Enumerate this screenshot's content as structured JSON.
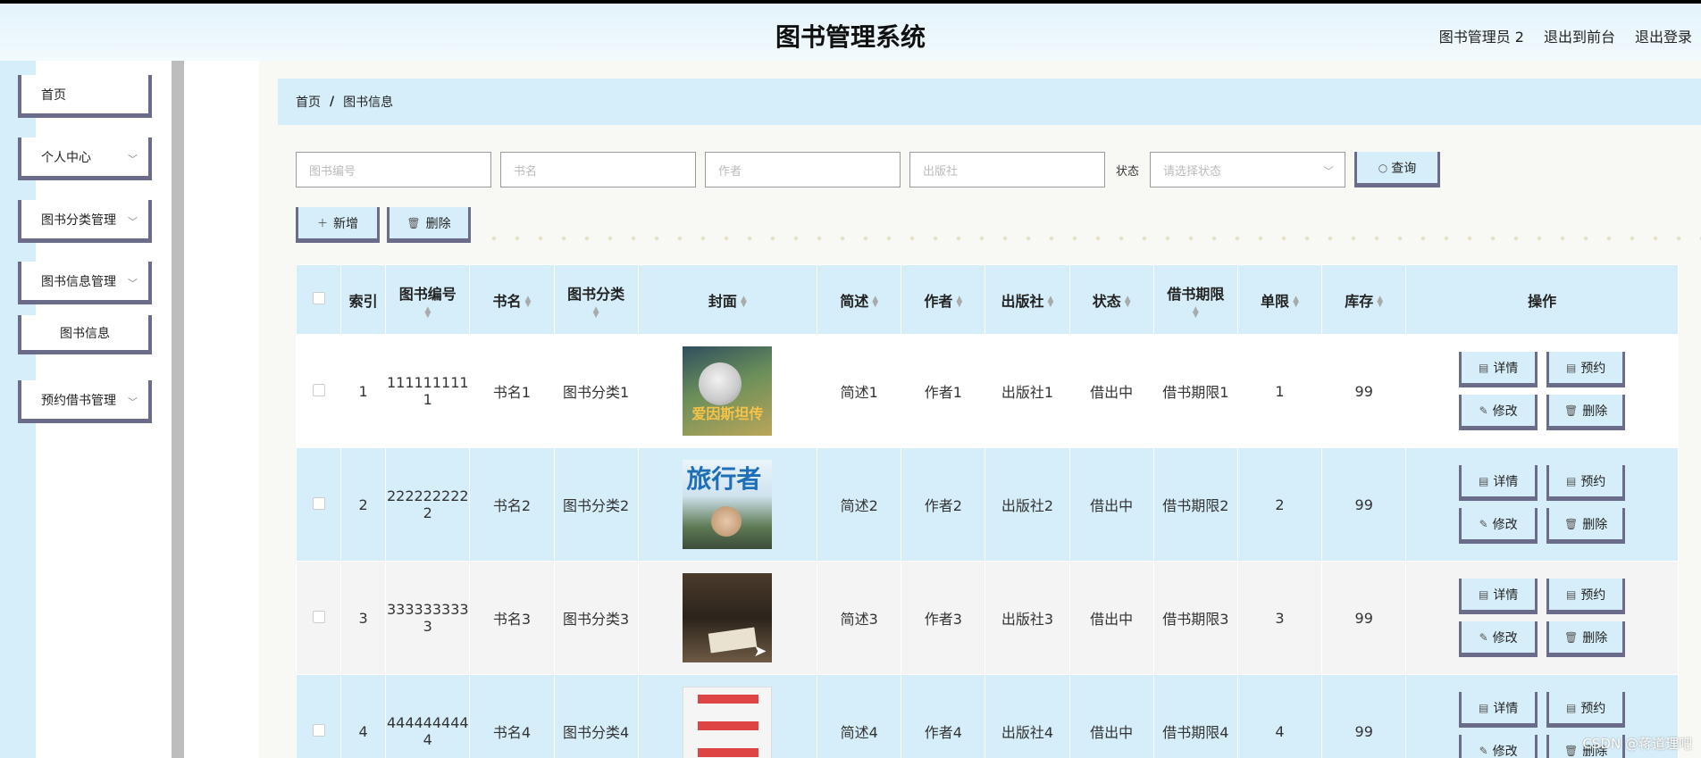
{
  "header": {
    "title": "图书管理系统",
    "user": "图书管理员 2",
    "back_to_front": "退出到前台",
    "logout": "退出登录"
  },
  "sidebar": {
    "items": [
      {
        "label": "首页"
      },
      {
        "label": "个人中心"
      },
      {
        "label": "图书分类管理"
      },
      {
        "label": "图书信息管理"
      },
      {
        "label": "图书信息"
      },
      {
        "label": "预约借书管理"
      }
    ]
  },
  "breadcrumb": {
    "home": "首页",
    "sep": "/",
    "current": "图书信息"
  },
  "search": {
    "book_no_placeholder": "图书编号",
    "title_placeholder": "书名",
    "author_placeholder": "作者",
    "publisher_placeholder": "出版社",
    "status_label": "状态",
    "status_placeholder": "请选择状态",
    "query_label": "查询"
  },
  "actions": {
    "add_label": "新增",
    "delete_label": "删除"
  },
  "table": {
    "headers": {
      "index": "索引",
      "book_no": "图书编号",
      "title": "书名",
      "category": "图书分类",
      "cover": "封面",
      "summary": "简述",
      "author": "作者",
      "publisher": "出版社",
      "status": "状态",
      "period": "借书期限",
      "limit": "单限",
      "stock": "库存",
      "ops": "操作"
    },
    "rows": [
      {
        "index": "1",
        "book_no": "1111111111",
        "title": "书名1",
        "category": "图书分类1",
        "cover_title": "爱因斯坦传",
        "summary": "简述1",
        "author": "作者1",
        "publisher": "出版社1",
        "status": "借出中",
        "period": "借书期限1",
        "limit": "1",
        "stock": "99"
      },
      {
        "index": "2",
        "book_no": "2222222222",
        "title": "书名2",
        "category": "图书分类2",
        "cover_title": "旅行者",
        "summary": "简述2",
        "author": "作者2",
        "publisher": "出版社2",
        "status": "借出中",
        "period": "借书期限2",
        "limit": "2",
        "stock": "99"
      },
      {
        "index": "3",
        "book_no": "3333333333",
        "title": "书名3",
        "category": "图书分类3",
        "cover_title": "",
        "summary": "简述3",
        "author": "作者3",
        "publisher": "出版社3",
        "status": "借出中",
        "period": "借书期限3",
        "limit": "3",
        "stock": "99"
      },
      {
        "index": "4",
        "book_no": "4444444444",
        "title": "书名4",
        "category": "图书分类4",
        "cover_title": "",
        "summary": "简述4",
        "author": "作者4",
        "publisher": "出版社4",
        "status": "借出中",
        "period": "借书期限4",
        "limit": "4",
        "stock": "99"
      }
    ],
    "op_labels": {
      "detail": "详情",
      "reserve": "预约",
      "edit": "修改",
      "delete": "删除"
    }
  },
  "watermark": "CSDN @蒋道理吧",
  "colors": {
    "accent": "#d6eef9",
    "border": "#6b6b8a"
  }
}
